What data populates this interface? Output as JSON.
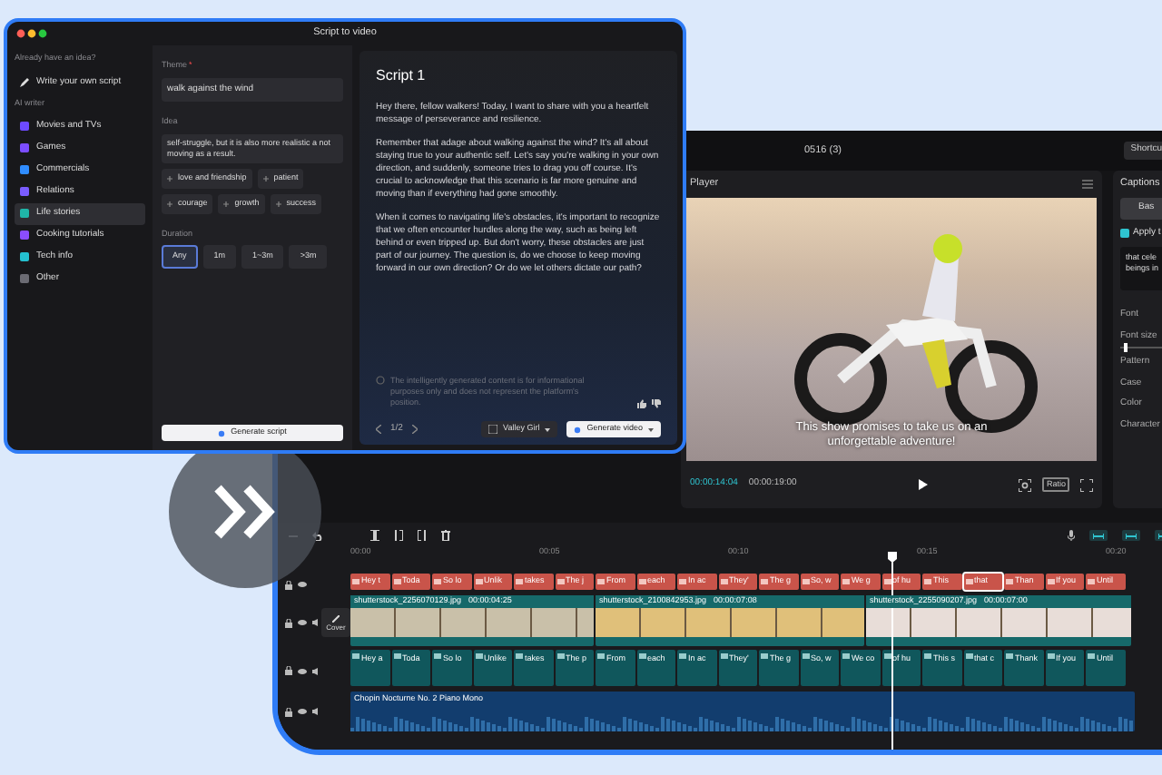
{
  "script_window": {
    "title": "Script to video",
    "sidebar": {
      "heading": "Already have an idea?",
      "write_own": "Write your own script",
      "section": "AI writer",
      "items": [
        {
          "label": "Movies and TVs",
          "selected": false,
          "color": "#6d4aff"
        },
        {
          "label": "Games",
          "selected": false,
          "color": "#7b4dff"
        },
        {
          "label": "Commercials",
          "selected": false,
          "color": "#2f8cff"
        },
        {
          "label": "Relations",
          "selected": false,
          "color": "#7a5cff"
        },
        {
          "label": "Life stories",
          "selected": true,
          "color": "#1fb5a8"
        },
        {
          "label": "Cooking tutorials",
          "selected": false,
          "color": "#8a4dff"
        },
        {
          "label": "Tech info",
          "selected": false,
          "color": "#24c0d0"
        },
        {
          "label": "Other",
          "selected": false,
          "color": "#6b6b73"
        }
      ]
    },
    "form": {
      "theme_label": "Theme",
      "required_mark": "*",
      "theme_value": "walk against the wind",
      "idea_label": "Idea",
      "idea_value": "self-struggle, but it is also more realistic a not moving as a result.",
      "tags": [
        "love and friendship",
        "patient",
        "courage",
        "growth",
        "success"
      ],
      "duration_label": "Duration",
      "durations": [
        {
          "label": "Any",
          "selected": true
        },
        {
          "label": "1m",
          "selected": false
        },
        {
          "label": "1~3m",
          "selected": false
        },
        {
          "label": ">3m",
          "selected": false
        }
      ],
      "generate_button": "Generate script"
    },
    "script": {
      "title": "Script 1",
      "paragraphs": [
        "Hey there, fellow walkers! Today, I want to share with you a heartfelt message of perseverance and resilience.",
        "Remember that adage about walking against the wind? It's all about staying true to your authentic self. Let's say you're walking in your own direction, and suddenly, someone tries to drag you off course. It's crucial to acknowledge that this scenario is far more genuine and moving than if everything had gone smoothly.",
        "When it comes to navigating life's obstacles, it's important to recognize that we often encounter hurdles along the way, such as being left behind or even tripped up. But don't worry, these obstacles are just part of our journey. The question is, do we choose to keep moving forward in our own direction? Or do we let others dictate our path?"
      ],
      "disclaimer": "The intelligently generated content is for informational purposes only and does not represent the platform's position.",
      "pager": "1/2",
      "voice": "Valley Girl",
      "generate_button": "Generate video"
    }
  },
  "editor": {
    "project_title": "0516 (3)",
    "shortcut_label": "Shortcu",
    "player": {
      "title": "Player",
      "subtitle": "This show promises to take us on an unforgettable adventure!",
      "current_time": "00:00:14:04",
      "total_time": "00:00:19:00",
      "ratio_button": "Ratio"
    },
    "captions_panel": {
      "tab": "Captions",
      "button": "Bas",
      "apply_label": "Apply t",
      "apply_checked": true,
      "text_lines": [
        "that cele",
        "beings in"
      ],
      "labels": [
        "Font",
        "Font size",
        "Pattern",
        "Case",
        "Color",
        "Character"
      ],
      "font_size": {
        "level": 0.06
      }
    },
    "timeline": {
      "ruler": [
        "00:00",
        "00:05",
        "00:10",
        "00:15",
        "00:20"
      ],
      "cover_button": "Cover",
      "caption_clips": [
        {
          "label": "Hey t",
          "selected": false
        },
        {
          "label": "Toda",
          "selected": false
        },
        {
          "label": "So lo",
          "selected": false
        },
        {
          "label": "Unlik",
          "selected": false
        },
        {
          "label": "takes",
          "selected": false
        },
        {
          "label": "The j",
          "selected": false
        },
        {
          "label": "From",
          "selected": false
        },
        {
          "label": "each",
          "selected": false
        },
        {
          "label": "In ac",
          "selected": false
        },
        {
          "label": "They'",
          "selected": false
        },
        {
          "label": "The g",
          "selected": false
        },
        {
          "label": "So, w",
          "selected": false
        },
        {
          "label": "We g",
          "selected": false
        },
        {
          "label": "of hu",
          "selected": false
        },
        {
          "label": "This",
          "selected": false
        },
        {
          "label": "that",
          "selected": true
        },
        {
          "label": "Than",
          "selected": false
        },
        {
          "label": "If you",
          "selected": false
        },
        {
          "label": "Until",
          "selected": false
        }
      ],
      "video_clips": [
        {
          "file": "shutterstock_2256070129.jpg",
          "duration": "00:00:04:25"
        },
        {
          "file": "shutterstock_2100842953.jpg",
          "duration": "00:00:07:08"
        },
        {
          "file": "shutterstock_2255090207.jpg",
          "duration": "00:00:07:00"
        }
      ],
      "text_clips": [
        "Hey a",
        "Toda",
        "So lo",
        "Unlike",
        "takes",
        "The p",
        "From",
        "each",
        "In ac",
        "They'",
        "The g",
        "So, w",
        "We co",
        "of hu",
        "This s",
        "that c",
        "Thank",
        "If you",
        "Until"
      ],
      "audio_clip": "Chopin Nocturne No. 2 Piano Mono"
    }
  }
}
